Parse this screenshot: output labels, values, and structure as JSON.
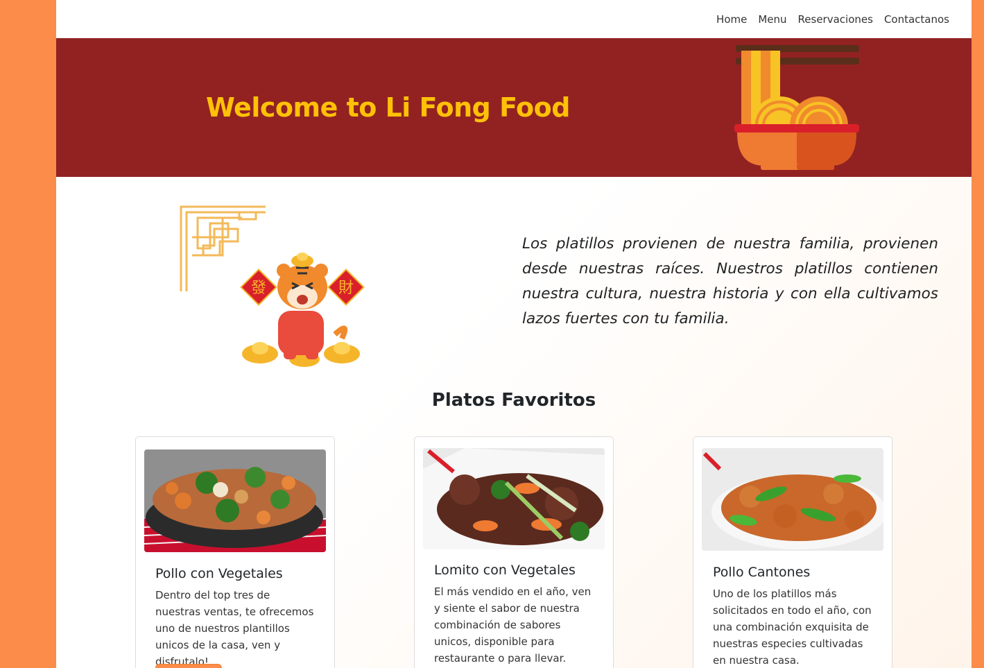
{
  "nav": {
    "items": [
      {
        "label": "Home"
      },
      {
        "label": "Menu"
      },
      {
        "label": "Reservaciones"
      },
      {
        "label": "Contactanos"
      }
    ]
  },
  "hero": {
    "title": "Welcome to Li Fong Food",
    "image_icon": "noodle-bowl-icon"
  },
  "about": {
    "text": "Los platillos provienen de nuestra familia, provienen desde nuestras raíces. Nuestros platillos contienen nuestra cultura, nuestra historia y con ella cultivamos lazos fuertes con tu familia.",
    "ornament_icon": "chinese-corner-ornament",
    "mascot_icon": "tiger-mascot",
    "mascot_sign_left": "發",
    "mascot_sign_right": "財"
  },
  "favorites": {
    "title": "Platos Favoritos",
    "cards": [
      {
        "title": "Pollo con Vegetales",
        "text": "Dentro del top tres de nuestras ventas, te ofrecemos uno de nuestros plantillos unicos de la casa, ven y disfrutalo!",
        "image": "chicken-vegetables-photo"
      },
      {
        "title": "Lomito con Vegetales",
        "text": "El más vendido en el año, ven y siente el sabor de nuestra combinación de sabores unicos, disponible para restaurante o para llevar.",
        "image": "beef-vegetables-photo"
      },
      {
        "title": "Pollo Cantones",
        "text": "Uno de los platillos más solicitados en todo el año, con una combinación exquisita de nuestras especies cultivadas en nuestra casa.",
        "image": "cantonese-chicken-photo"
      }
    ]
  },
  "colors": {
    "outer_background": "#fb8c4a",
    "hero_background": "#922222",
    "hero_title": "#ffc107",
    "button": "#fb8c4a"
  }
}
